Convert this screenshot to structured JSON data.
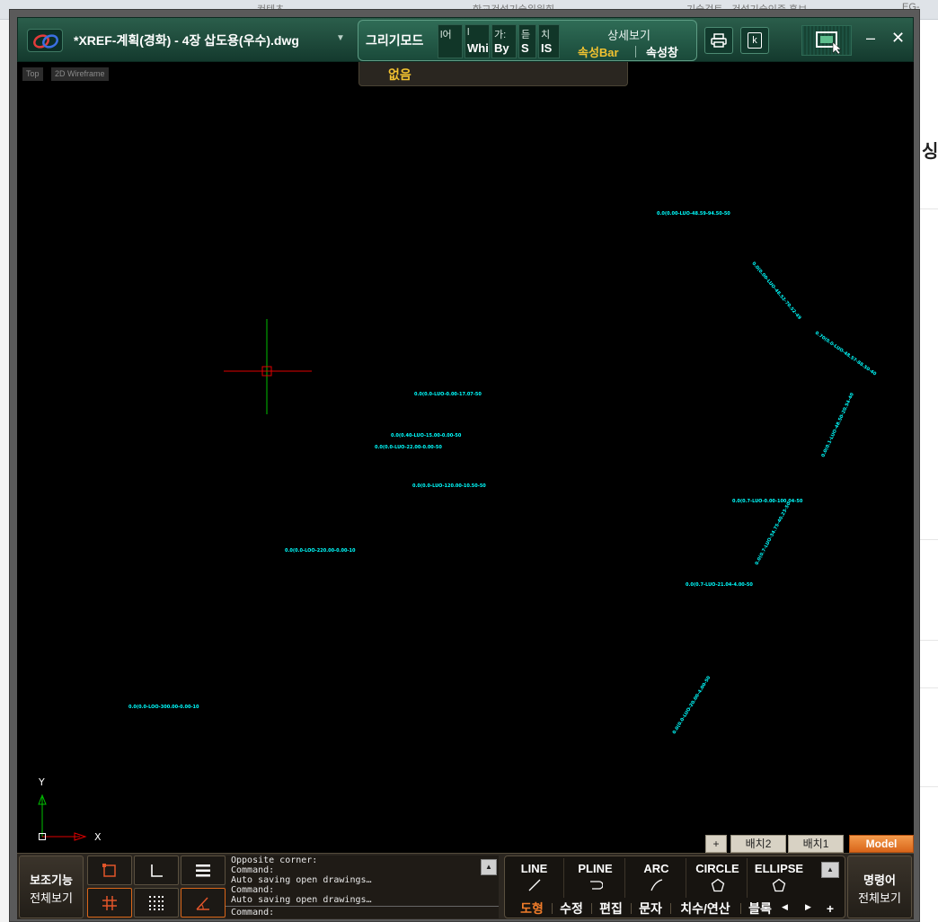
{
  "app": {
    "file_title": "*XREF-계획(경화) - 4장 삽도용(우수).dwg",
    "draw_mode_label": "그리기모드",
    "mode_slots": [
      {
        "top": "l어",
        "bottom": ""
      },
      {
        "top": "l",
        "bottom": "Whit"
      },
      {
        "top": "가:",
        "bottom": "By"
      },
      {
        "top": "듣",
        "bottom": "S"
      },
      {
        "top": "치",
        "bottom": "IS"
      }
    ],
    "detail_view": "상세보기",
    "prop_bar": "속성Bar",
    "prop_window": "속성창",
    "dropdown_value": "없음",
    "k_label": "k",
    "minimize": "–",
    "close": "✕"
  },
  "viewport": {
    "view_label": "Top",
    "style_label": "2D Wireframe",
    "ucs_y": "Y",
    "ucs_x": "X"
  },
  "drawing_labels": [
    {
      "text": "0.0(0.00-LUO-48.59-94.50-50"
    },
    {
      "text": "0.0(0.00-LUO-48.52-70.52-49"
    },
    {
      "text": "0.70(0.0-LUO-48.57-88.50-40"
    },
    {
      "text": "0.0(0.1-LUO-48.50-20.54-40"
    },
    {
      "text": "0.0(0.0-LUO-0.00-17.07-50"
    },
    {
      "text": "0.0(0.40-LUO-15.00-0.00-50"
    },
    {
      "text": "0.0(0.0-LUO-22.00-0.00-50"
    },
    {
      "text": "0.0(0.0-LUO-120.00-10.50-50"
    },
    {
      "text": "0.0(0.7-LUO-0.00-100.04-50"
    },
    {
      "text": "0.0(0.7-LUO-34.75-40.23-50"
    },
    {
      "text": "0.0(0.0-LOO-220.00-0.00-10"
    },
    {
      "text": "0.0(0.7-LUO-21.04-4.00-50"
    },
    {
      "text": "0.0(0.0-LOO-300.00-0.00-10"
    },
    {
      "text": "0.0(0.0-LUO-20.00-4.00-50"
    }
  ],
  "layout_tabs": {
    "add": "+",
    "tabs": [
      "배치2",
      "배치1"
    ],
    "model": "Model"
  },
  "dock": {
    "aux_line1": "보조기능",
    "aux_line2": "전체보기",
    "command_history": [
      "Opposite corner:",
      "Command:",
      "Auto saving open drawings…",
      "Command:",
      "Auto saving open drawings…"
    ],
    "command_prompt": "Command:",
    "draw_commands": [
      "LINE",
      "PLINE",
      "ARC",
      "CIRCLE",
      "ELLIPSE"
    ],
    "panel_tabs": [
      "도형",
      "수정",
      "편집",
      "문자",
      "치수/연산",
      "블록"
    ],
    "cmd_line1": "명령어",
    "cmd_line2": "전체보기",
    "add_tab": "+"
  },
  "background": {
    "tab_texts": [
      "",
      "컨텐츠",
      "학교건설기술위원회",
      "기술검토 · 건설기술인증 홍보",
      "EG-"
    ],
    "side_text": "싱"
  },
  "colors": {
    "canvas": "#000000",
    "cyan_text": "#00ffff",
    "accent_orange": "#f07c2a",
    "titlebar_green": "#1f4a3c",
    "bar_yellow": "#f2c230"
  }
}
